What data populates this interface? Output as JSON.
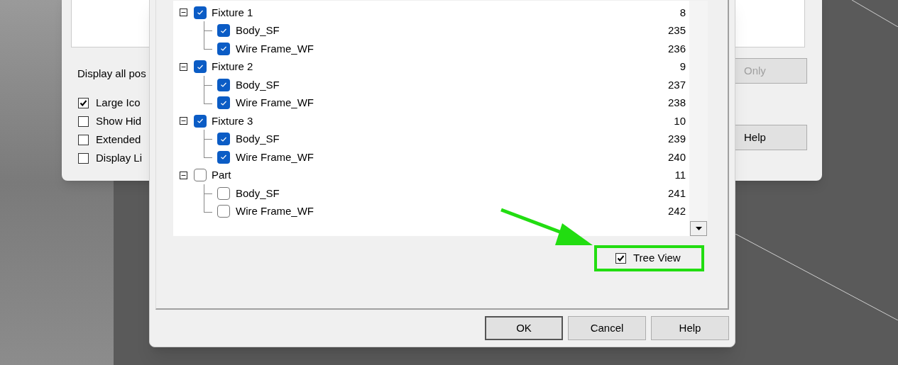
{
  "back_dialog": {
    "description": "Display all pos",
    "options": [
      {
        "label": "Large Ico",
        "checked": true
      },
      {
        "label": "Show Hid",
        "checked": false
      },
      {
        "label": "Extended",
        "checked": false
      },
      {
        "label": "Display Li",
        "checked": false
      }
    ],
    "buttons": [
      {
        "label": "Only",
        "disabled": true
      },
      {
        "label": "Help",
        "disabled": false
      }
    ]
  },
  "dialog": {
    "tree": [
      {
        "label": "Fixture 1",
        "number": "8",
        "checked": true,
        "expanded": true,
        "children": [
          {
            "label": "Body_SF",
            "number": "235",
            "checked": true
          },
          {
            "label": "Wire Frame_WF",
            "number": "236",
            "checked": true
          }
        ]
      },
      {
        "label": "Fixture 2",
        "number": "9",
        "checked": true,
        "expanded": true,
        "children": [
          {
            "label": "Body_SF",
            "number": "237",
            "checked": true
          },
          {
            "label": "Wire Frame_WF",
            "number": "238",
            "checked": true
          }
        ]
      },
      {
        "label": "Fixture 3",
        "number": "10",
        "checked": true,
        "expanded": true,
        "children": [
          {
            "label": "Body_SF",
            "number": "239",
            "checked": true
          },
          {
            "label": "Wire Frame_WF",
            "number": "240",
            "checked": true
          }
        ]
      },
      {
        "label": "Part",
        "number": "11",
        "checked": false,
        "expanded": true,
        "children": [
          {
            "label": "Body_SF",
            "number": "241",
            "checked": false
          },
          {
            "label": "Wire Frame_WF",
            "number": "242",
            "checked": false
          }
        ]
      }
    ],
    "tree_view": {
      "label": "Tree View",
      "checked": true
    },
    "buttons": [
      "OK",
      "Cancel",
      "Help"
    ]
  }
}
